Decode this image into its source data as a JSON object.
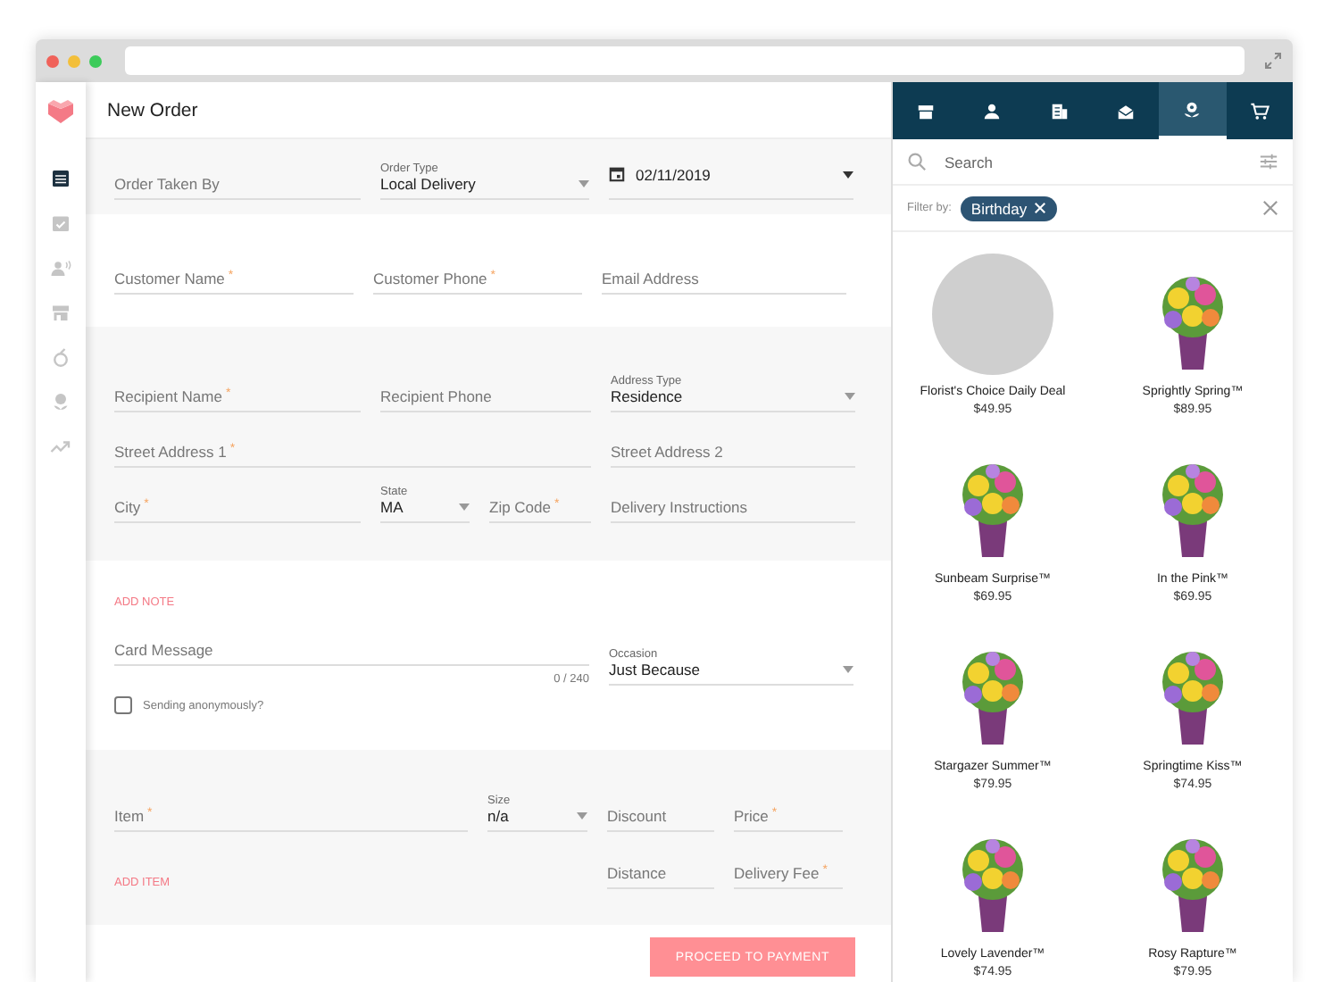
{
  "header": {
    "title": "New Order"
  },
  "nav": [
    {
      "selected": true
    },
    {
      "selected": false
    },
    {
      "selected": false
    },
    {
      "selected": false
    },
    {
      "selected": false
    },
    {
      "selected": false
    },
    {
      "selected": false
    }
  ],
  "sections": [
    {
      "rows": [
        [
          {
            "kind": "text",
            "label": "Order Taken By"
          },
          {
            "kind": "select",
            "label": "Order Type",
            "value": "Local Delivery"
          },
          {
            "kind": "date",
            "value": "02/11/2019"
          }
        ]
      ]
    },
    {
      "rows": [
        [
          {
            "kind": "text",
            "label": "Customer Name",
            "required": "*"
          },
          {
            "kind": "text",
            "label": "Customer Phone",
            "required": "*"
          },
          {
            "kind": "text",
            "label": "Email Address"
          }
        ]
      ]
    },
    {
      "rows": [
        [
          {
            "kind": "text",
            "label": "Recipient Name",
            "required": "*"
          },
          {
            "kind": "text",
            "label": "Recipient Phone"
          },
          "",
          {
            "kind": "select",
            "label": "Address Type",
            "value": "Residence"
          }
        ],
        [
          {
            "kind": "text",
            "label": "Street Address 1",
            "required": "*"
          },
          "",
          "",
          {
            "kind": "text",
            "label": "Street Address 2"
          }
        ],
        [
          {
            "kind": "text",
            "label": "City",
            "required": "*"
          },
          {
            "kind": "select",
            "label": "State",
            "value": "MA"
          },
          {
            "kind": "text",
            "label": "Zip Code",
            "required": "*"
          },
          {
            "kind": "text",
            "label": "Delivery Instructions"
          }
        ]
      ]
    },
    {
      "rows": [
        [
          {
            "kind": "link",
            "label": "ADD NOTE"
          }
        ],
        [
          {
            "kind": "message",
            "label": "Card Message",
            "counter": "0 / 240"
          },
          {
            "kind": "select",
            "label": "Occasion",
            "value": "Just Because"
          }
        ],
        [
          {
            "kind": "checkbox",
            "label": "Sending anonymously?",
            "checked": false
          }
        ]
      ]
    },
    {
      "rows": [
        [
          {
            "kind": "text",
            "label": "Item",
            "required": "*"
          },
          {
            "kind": "select",
            "label": "Size",
            "value": "n/a"
          },
          {
            "kind": "text",
            "label": "Discount"
          },
          {
            "kind": "text",
            "label": "Price",
            "required": "*"
          }
        ],
        [
          {
            "kind": "link",
            "label": "ADD ITEM"
          },
          "",
          {
            "kind": "text",
            "label": "Distance"
          },
          {
            "kind": "text",
            "label": "Delivery Fee",
            "required": "*"
          }
        ]
      ]
    }
  ],
  "proceed_button": "PROCEED TO PAYMENT",
  "panel": {
    "tabs": [
      {
        "selected": false
      },
      {
        "selected": false
      },
      {
        "selected": false
      },
      {
        "selected": false
      },
      {
        "selected": true
      },
      {
        "selected": false
      }
    ],
    "search": {
      "placeholder": "Search"
    },
    "filter": {
      "label": "Filter by:",
      "chip": "Birthday"
    },
    "products": [
      {
        "name": "Florist's Choice Daily Deal",
        "price": "$49.95",
        "kind": "photo"
      },
      {
        "name": "Sprightly Spring™",
        "price": "$89.95",
        "kind": "bouquet"
      },
      {
        "name": "Sunbeam Surprise™",
        "price": "$69.95",
        "kind": "bouquet"
      },
      {
        "name": "In the Pink™",
        "price": "$69.95",
        "kind": "bouquet"
      },
      {
        "name": "Stargazer Summer™",
        "price": "$79.95",
        "kind": "bouquet"
      },
      {
        "name": "Springtime Kiss™",
        "price": "$74.95",
        "kind": "bouquet"
      },
      {
        "name": "Lovely Lavender™",
        "price": "$74.95",
        "kind": "bouquet"
      },
      {
        "name": "Rosy Rapture™",
        "price": "$79.95",
        "kind": "bouquet"
      }
    ]
  }
}
